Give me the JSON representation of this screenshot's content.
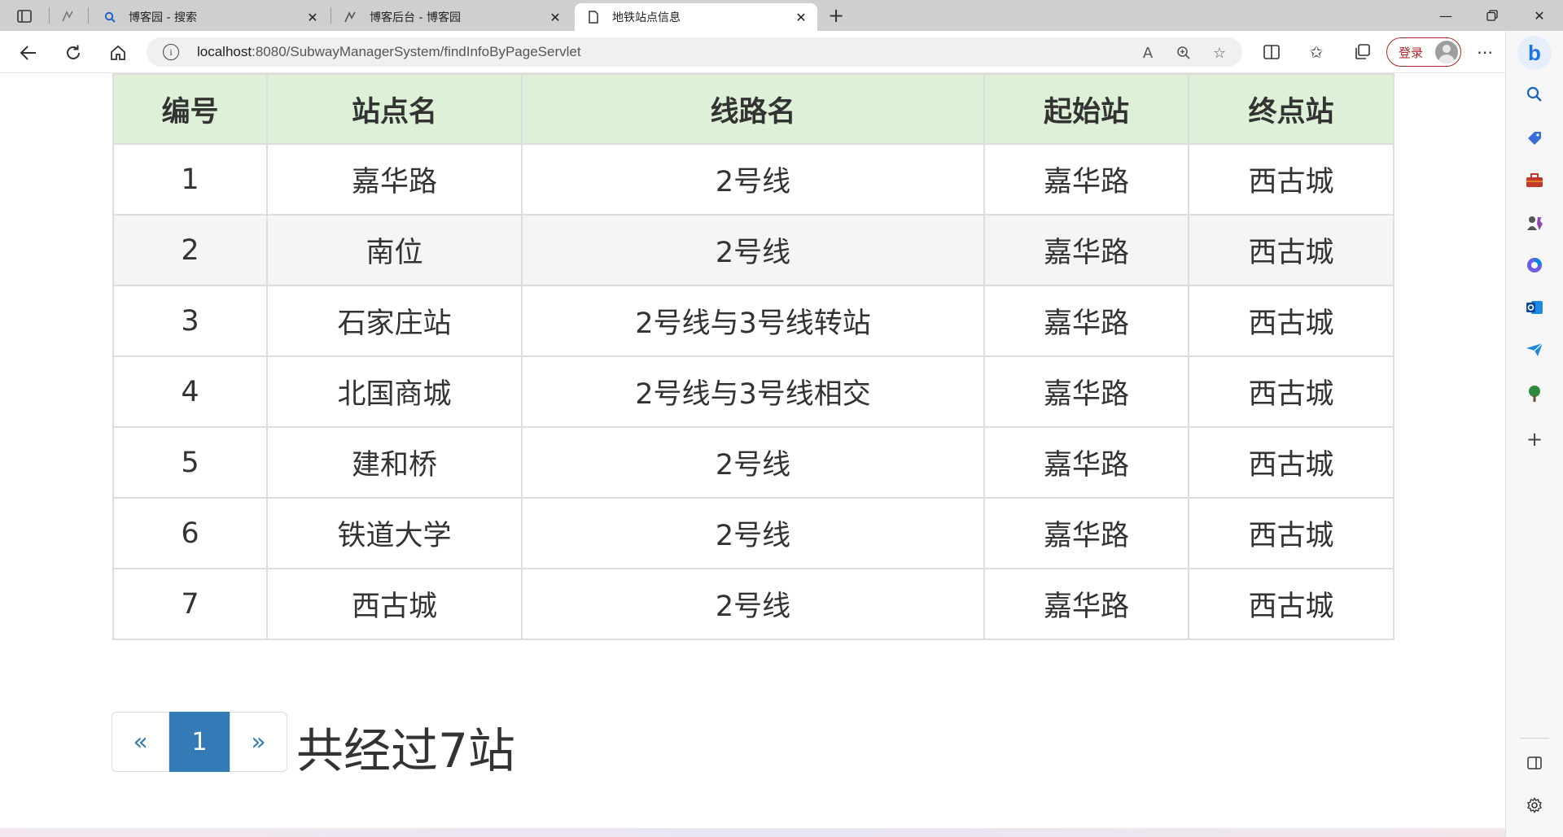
{
  "browser": {
    "tabs": [
      {
        "title": "博客园 - 搜索",
        "icon": "search-icon"
      },
      {
        "title": "博客后台 - 博客园",
        "icon": "cnblogs-icon"
      },
      {
        "title": "地铁站点信息",
        "icon": "page-icon",
        "active": true
      }
    ],
    "address": {
      "host": "localhost",
      "rest": ":8080/SubwayManagerSystem/findInfoByPageServlet"
    },
    "login_label": "登录"
  },
  "table": {
    "headers": [
      "编号",
      "站点名",
      "线路名",
      "起始站",
      "终点站"
    ],
    "rows": [
      [
        "1",
        "嘉华路",
        "2号线",
        "嘉华路",
        "西古城"
      ],
      [
        "2",
        "南位",
        "2号线",
        "嘉华路",
        "西古城"
      ],
      [
        "3",
        "石家庄站",
        "2号线与3号线转站",
        "嘉华路",
        "西古城"
      ],
      [
        "4",
        "北国商城",
        "2号线与3号线相交",
        "嘉华路",
        "西古城"
      ],
      [
        "5",
        "建和桥",
        "2号线",
        "嘉华路",
        "西古城"
      ],
      [
        "6",
        "铁道大学",
        "2号线",
        "嘉华路",
        "西古城"
      ],
      [
        "7",
        "西古城",
        "2号线",
        "嘉华路",
        "西古城"
      ]
    ]
  },
  "pagination": {
    "prev": "«",
    "current": "1",
    "next": "»",
    "summary": "共经过7站"
  },
  "colors": {
    "header_bg": "#dff0d8",
    "pager_active": "#337ab7",
    "login_accent": "#b3262e"
  }
}
